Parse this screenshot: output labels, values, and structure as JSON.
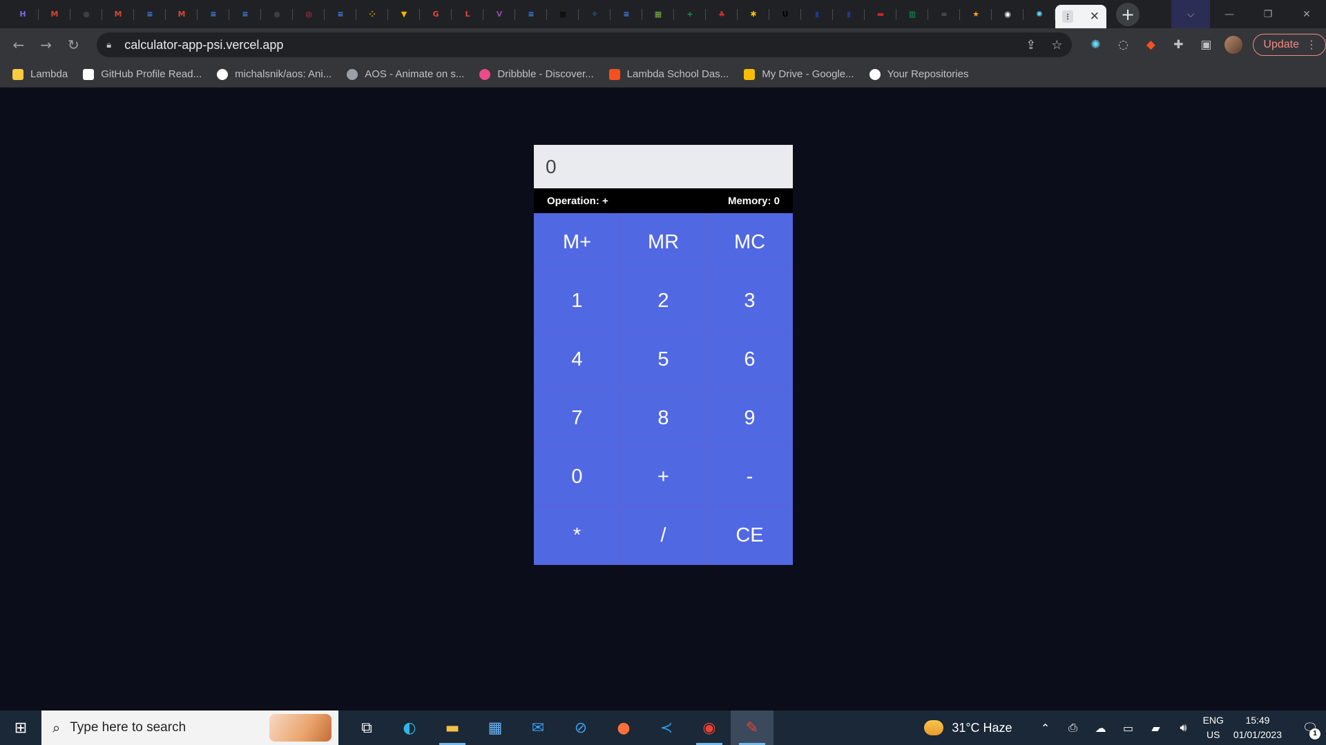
{
  "browser": {
    "tab_favicons": [
      {
        "icon": "h-icon",
        "color": "#7b68ee",
        "glyph": "H"
      },
      {
        "icon": "gmail-icon",
        "color": "#d44638",
        "glyph": "M"
      },
      {
        "icon": "github-icon",
        "color": "#3c4043",
        "glyph": "●"
      },
      {
        "icon": "gmail-icon",
        "color": "#d44638",
        "glyph": "M"
      },
      {
        "icon": "docs-icon",
        "color": "#4285f4",
        "glyph": "≡"
      },
      {
        "icon": "gmail-icon",
        "color": "#d44638",
        "glyph": "M"
      },
      {
        "icon": "docs-icon",
        "color": "#4285f4",
        "glyph": "≡"
      },
      {
        "icon": "docs-icon",
        "color": "#4285f4",
        "glyph": "≡"
      },
      {
        "icon": "github-icon",
        "color": "#3c4043",
        "glyph": "●"
      },
      {
        "icon": "tripadvisor-icon",
        "color": "#e0314b",
        "glyph": "◎"
      },
      {
        "icon": "docs-icon",
        "color": "#4285f4",
        "glyph": "≡"
      },
      {
        "icon": "dots-icon",
        "color": "#f2b600",
        "glyph": "⁘"
      },
      {
        "icon": "shield-icon",
        "color": "#f5b400",
        "glyph": "▼"
      },
      {
        "icon": "grammarly-icon",
        "color": "#e8453c",
        "glyph": "G"
      },
      {
        "icon": "l-icon",
        "color": "#e8453c",
        "glyph": "L"
      },
      {
        "icon": "v-icon",
        "color": "#8e44ad",
        "glyph": "V"
      },
      {
        "icon": "docs-icon",
        "color": "#4285f4",
        "glyph": "≡"
      },
      {
        "icon": "block-icon",
        "color": "#111111",
        "glyph": "■"
      },
      {
        "icon": "bird-icon",
        "color": "#1e88e5",
        "glyph": "✧"
      },
      {
        "icon": "docs-icon",
        "color": "#4285f4",
        "glyph": "≡"
      },
      {
        "icon": "chart-icon",
        "color": "#7cb342",
        "glyph": "▦"
      },
      {
        "icon": "sheets-plus-icon",
        "color": "#0f9d58",
        "glyph": "+"
      },
      {
        "icon": "maple-leaf-icon",
        "color": "#d32f2f",
        "glyph": "♣"
      },
      {
        "icon": "photos-icon",
        "color": "#fbbc05",
        "glyph": "✱"
      },
      {
        "icon": "ug-icon",
        "color": "#000000",
        "glyph": "U"
      },
      {
        "icon": "lighthouse-icon",
        "color": "#1a3c8e",
        "glyph": "▮"
      },
      {
        "icon": "lighthouse-icon",
        "color": "#1a3c8e",
        "glyph": "▮"
      },
      {
        "icon": "flag-icon",
        "color": "#c62828",
        "glyph": "▬"
      },
      {
        "icon": "sheets-icon",
        "color": "#0f9d58",
        "glyph": "▥"
      },
      {
        "icon": "link-icon",
        "color": "#5f6368",
        "glyph": "∞"
      },
      {
        "icon": "star-badge-icon",
        "color": "#f5a623",
        "glyph": "★"
      },
      {
        "icon": "chatgpt-icon",
        "color": "#ffffff",
        "glyph": "◉"
      },
      {
        "icon": "react-icon",
        "color": "#61dafb",
        "glyph": "✺"
      }
    ],
    "active_tab_close": "✕",
    "new_tab": "+",
    "url": "calculator-app-psi.vercel.app",
    "update_label": "Update"
  },
  "bookmarks": [
    {
      "label": "Lambda",
      "icon": "folder-icon",
      "color": "#f9cb40"
    },
    {
      "label": "GitHub Profile Read...",
      "icon": "mg-icon",
      "color": "#ffffff"
    },
    {
      "label": "michalsnik/aos: Ani...",
      "icon": "github-icon",
      "color": "#ffffff"
    },
    {
      "label": "AOS - Animate on s...",
      "icon": "globe-icon",
      "color": "#9aa0a6"
    },
    {
      "label": "Dribbble - Discover...",
      "icon": "dribbble-icon",
      "color": "#ea4c89"
    },
    {
      "label": "Lambda School Das...",
      "icon": "lambda-icon",
      "color": "#f4511e"
    },
    {
      "label": "My Drive - Google...",
      "icon": "drive-icon",
      "color": "#fbbc04"
    },
    {
      "label": "Your Repositories",
      "icon": "github-icon",
      "color": "#ffffff"
    }
  ],
  "calculator": {
    "display_value": "0",
    "operation_label": "Operation: +",
    "memory_label": "Memory: 0",
    "keys": [
      "M+",
      "MR",
      "MC",
      "1",
      "2",
      "3",
      "4",
      "5",
      "6",
      "7",
      "8",
      "9",
      "0",
      "+",
      "-",
      "*",
      "/",
      "CE"
    ],
    "accent": "#5168e3"
  },
  "taskbar": {
    "search_placeholder": "Type here to search",
    "weather": "31°C  Haze",
    "lang_top": "ENG",
    "lang_bottom": "US",
    "time": "15:49",
    "date": "01/01/2023",
    "notification_count": "1"
  }
}
